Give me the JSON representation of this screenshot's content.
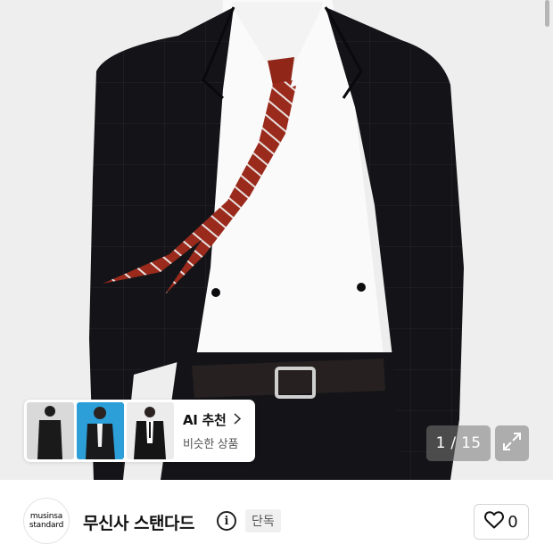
{
  "product_image": {
    "alt": "man in dark suit with red striped tie",
    "counter": "1 / 15",
    "expand_icon": "expand-arrows-icon"
  },
  "ai_recommend": {
    "title": "AI 추천",
    "subtitle": "비슷한 상품",
    "thumbnails": [
      "black-suit-model",
      "suit-on-blue-background",
      "suit-model-with-tie"
    ]
  },
  "brand": {
    "logo_line1": "musinsa",
    "logo_line2": "standard",
    "name": "무신사 스탠다드",
    "info_icon_glyph": "i",
    "badge": "단독"
  },
  "like": {
    "count": "0",
    "icon": "heart-outline-icon"
  },
  "colors": {
    "photo_bg": "#eeeeee",
    "suit": "#141418",
    "tie": "#9a2a1c"
  }
}
